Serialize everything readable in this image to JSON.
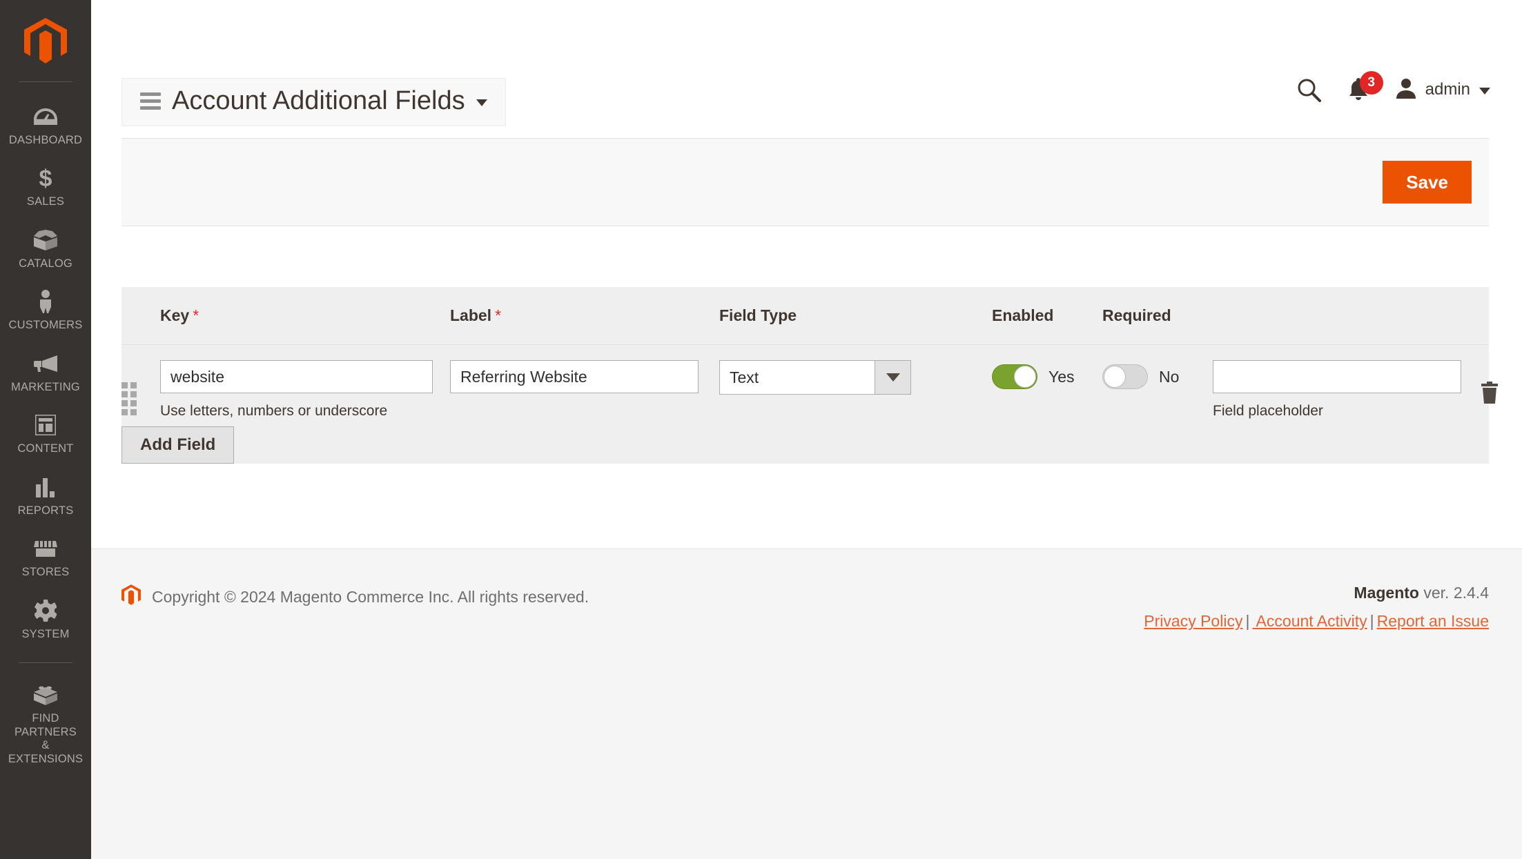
{
  "sidebar": {
    "logo_icon": "magento-logo-icon",
    "items": [
      {
        "label": "DASHBOARD",
        "icon": "dashboard-gauge-icon"
      },
      {
        "label": "SALES",
        "icon": "dollar-sign-icon"
      },
      {
        "label": "CATALOG",
        "icon": "box-icon"
      },
      {
        "label": "CUSTOMERS",
        "icon": "person-icon"
      },
      {
        "label": "MARKETING",
        "icon": "megaphone-icon"
      },
      {
        "label": "CONTENT",
        "icon": "layout-panel-icon"
      },
      {
        "label": "REPORTS",
        "icon": "bar-chart-icon"
      },
      {
        "label": "STORES",
        "icon": "storefront-icon"
      },
      {
        "label": "SYSTEM",
        "icon": "gear-icon"
      }
    ],
    "extensions": {
      "label": "FIND PARTNERS\n& EXTENSIONS",
      "icon": "lego-brick-icon"
    }
  },
  "header": {
    "title": "Account Additional Fields",
    "menu_icon": "hamburger-menu-icon",
    "title_caret_icon": "chevron-down-icon",
    "search_icon": "search-icon",
    "notifications_icon": "bell-icon",
    "notifications_count": "3",
    "avatar_icon": "user-avatar-icon",
    "user_name": "admin",
    "user_caret_icon": "chevron-down-icon"
  },
  "page_actions": {
    "save_label": "Save"
  },
  "fields_table": {
    "columns": [
      {
        "label": "Key",
        "required": true
      },
      {
        "label": "Label",
        "required": true
      },
      {
        "label": "Field Type",
        "required": false
      },
      {
        "label": "Enabled",
        "required": false
      },
      {
        "label": "Required",
        "required": false
      }
    ],
    "required_marker": "*",
    "rows": [
      {
        "drag_handle_icon": "drag-handle-icon",
        "key_value": "website",
        "key_placeholder": "",
        "key_hint": "Use letters, numbers or underscore",
        "label_value": "Referring Website",
        "label_placeholder": "",
        "field_type_value": "Text",
        "field_type_options": [
          "Text"
        ],
        "enabled_state": "Yes",
        "required_state": "No",
        "placeholder_value": "",
        "placeholder_input_placeholder": "",
        "placeholder_hint": "Field placeholder",
        "delete_icon": "trash-icon"
      }
    ],
    "add_field_label": "Add Field"
  },
  "footer": {
    "logo_icon": "magento-logo-icon",
    "copyright": "Copyright © 2024 Magento Commerce Inc. All rights reserved.",
    "product_name": "Magento",
    "version_text": " ver. 2.4.4",
    "links": [
      {
        "label": "Privacy Policy"
      },
      {
        "label": " Account Activity"
      },
      {
        "label": "Report an Issue"
      }
    ],
    "link_separator": "|"
  },
  "colors": {
    "brand_orange": "#eb5202",
    "sidebar_bg": "#373330",
    "toggle_on": "#79a22e",
    "badge_red": "#e22626",
    "link_orange": "#e0663a",
    "required_red": "#e02b27"
  }
}
